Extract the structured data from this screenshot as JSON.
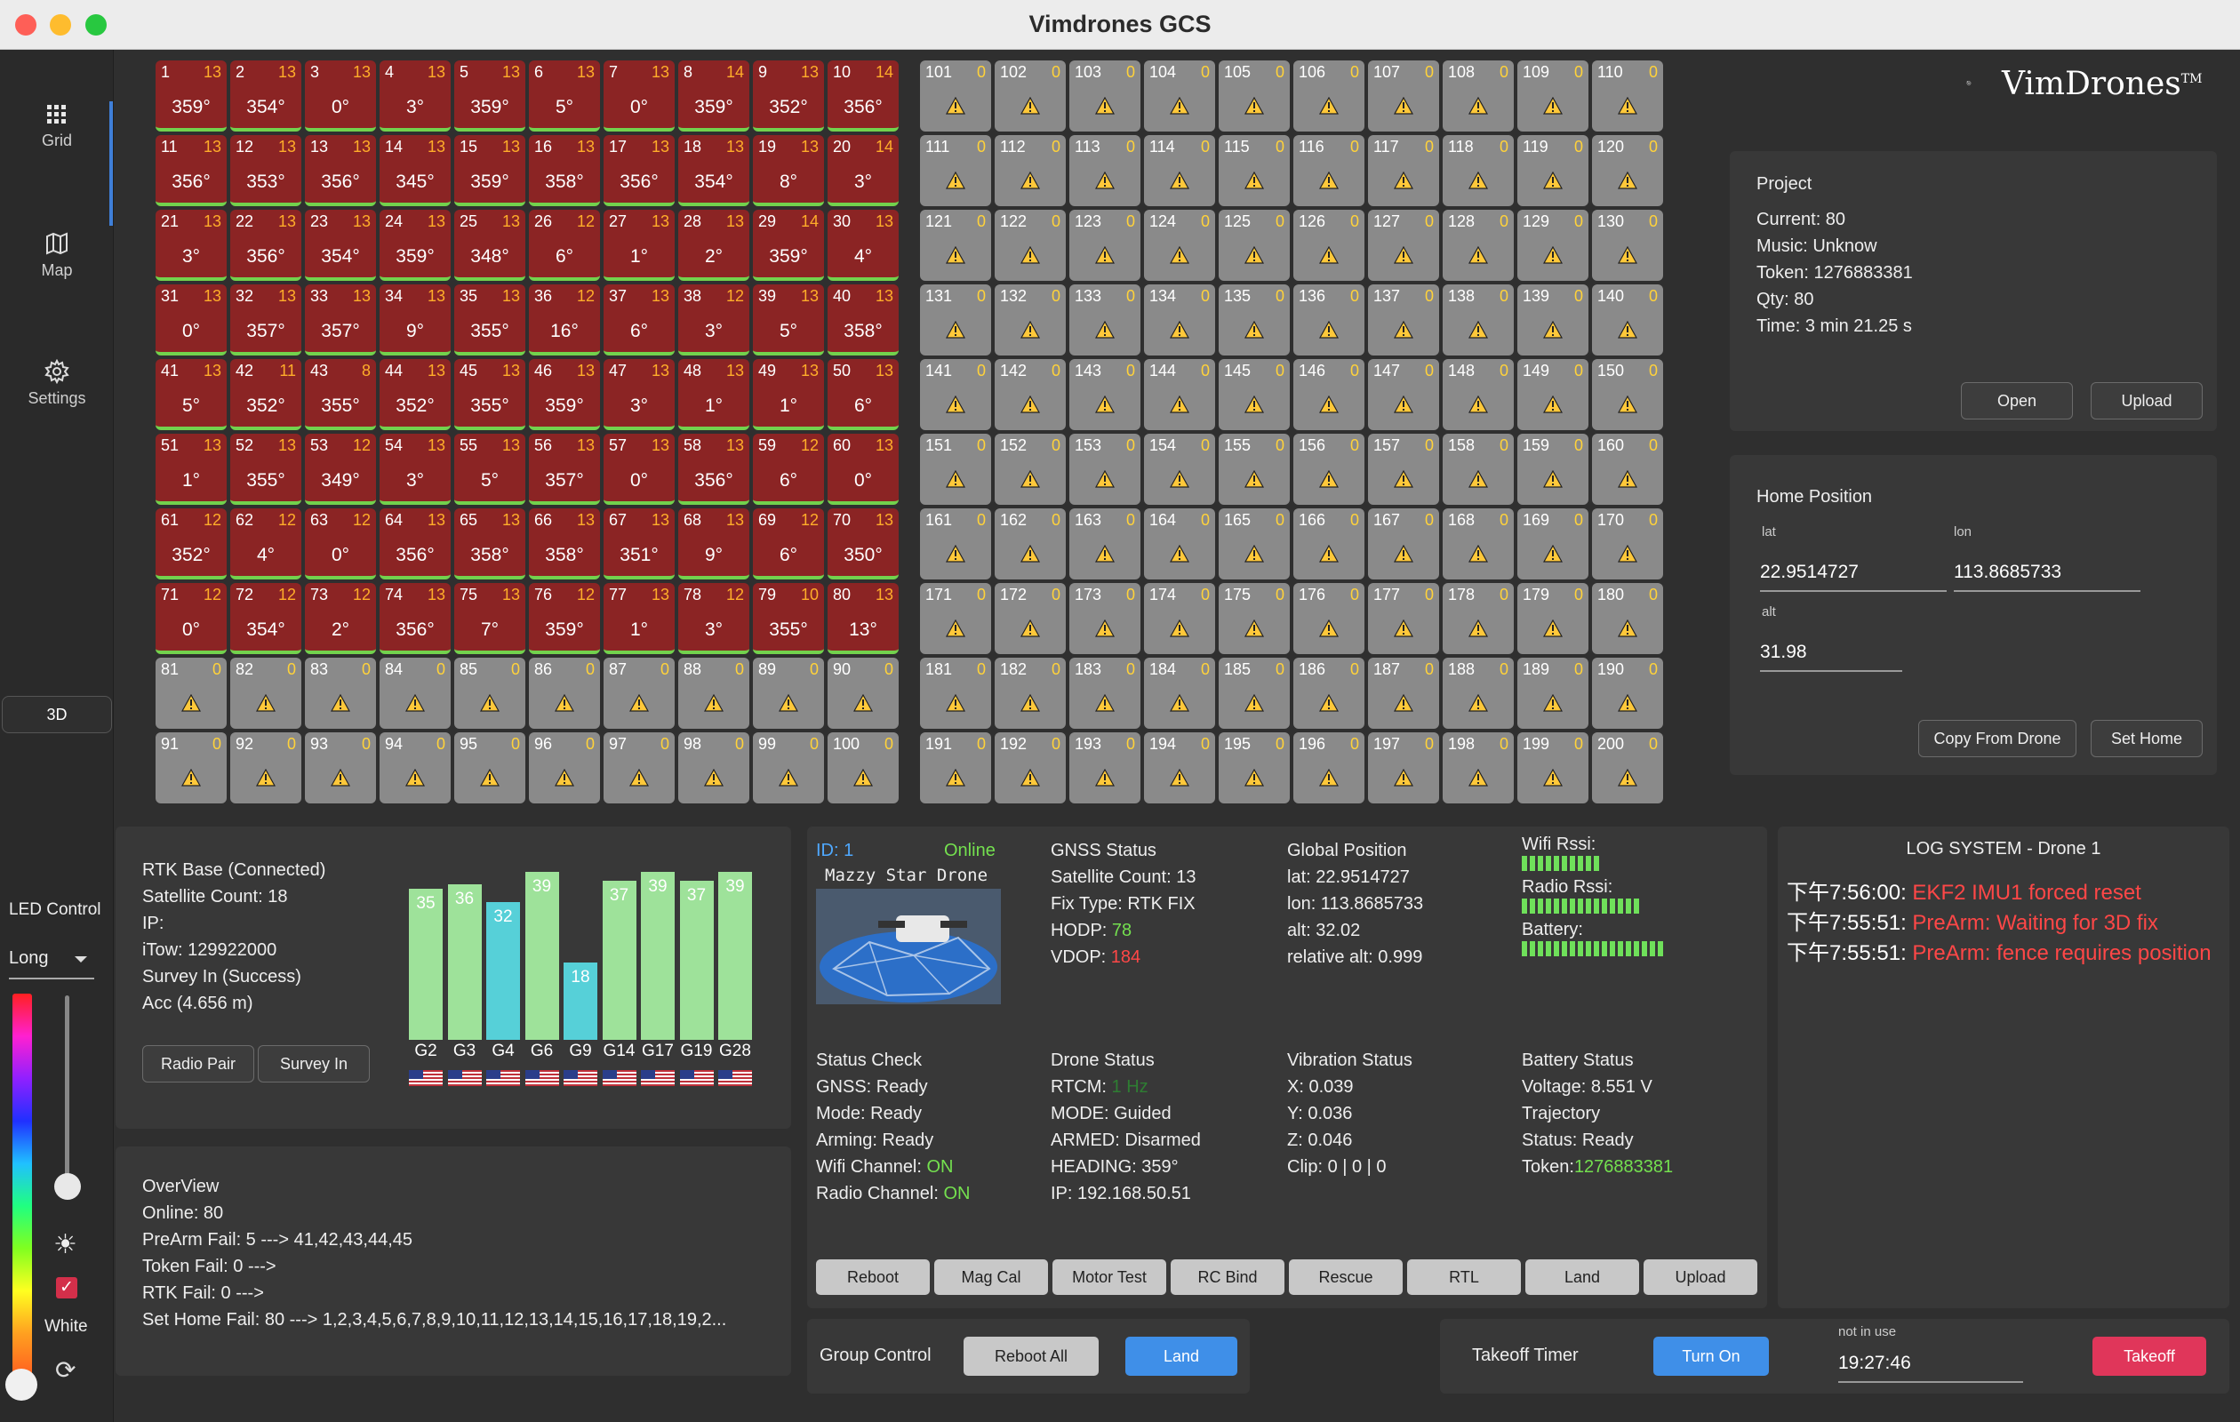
{
  "window": {
    "title": "Vimdrones GCS"
  },
  "sidebar": {
    "items": [
      {
        "label": "Grid",
        "icon": "grid-icon"
      },
      {
        "label": "Map",
        "icon": "map-icon"
      },
      {
        "label": "Settings",
        "icon": "gear-icon"
      }
    ],
    "view_toggle": "3D"
  },
  "led": {
    "title": "LED Control",
    "mode": "Long",
    "white_label": "White",
    "white_checked": true
  },
  "logo": {
    "text": "VimDrones",
    "tm": "TM"
  },
  "grid": {
    "online": [
      {
        "id": 1,
        "sat": 13,
        "heading": "359°"
      },
      {
        "id": 2,
        "sat": 13,
        "heading": "354°"
      },
      {
        "id": 3,
        "sat": 13,
        "heading": "0°"
      },
      {
        "id": 4,
        "sat": 13,
        "heading": "3°"
      },
      {
        "id": 5,
        "sat": 13,
        "heading": "359°"
      },
      {
        "id": 6,
        "sat": 13,
        "heading": "5°"
      },
      {
        "id": 7,
        "sat": 13,
        "heading": "0°"
      },
      {
        "id": 8,
        "sat": 14,
        "heading": "359°"
      },
      {
        "id": 9,
        "sat": 13,
        "heading": "352°"
      },
      {
        "id": 10,
        "sat": 14,
        "heading": "356°"
      },
      {
        "id": 11,
        "sat": 13,
        "heading": "356°"
      },
      {
        "id": 12,
        "sat": 13,
        "heading": "353°"
      },
      {
        "id": 13,
        "sat": 13,
        "heading": "356°"
      },
      {
        "id": 14,
        "sat": 13,
        "heading": "345°"
      },
      {
        "id": 15,
        "sat": 13,
        "heading": "359°"
      },
      {
        "id": 16,
        "sat": 13,
        "heading": "358°"
      },
      {
        "id": 17,
        "sat": 13,
        "heading": "356°"
      },
      {
        "id": 18,
        "sat": 13,
        "heading": "354°"
      },
      {
        "id": 19,
        "sat": 13,
        "heading": "8°"
      },
      {
        "id": 20,
        "sat": 14,
        "heading": "3°"
      },
      {
        "id": 21,
        "sat": 13,
        "heading": "3°"
      },
      {
        "id": 22,
        "sat": 13,
        "heading": "356°"
      },
      {
        "id": 23,
        "sat": 13,
        "heading": "354°"
      },
      {
        "id": 24,
        "sat": 13,
        "heading": "359°"
      },
      {
        "id": 25,
        "sat": 13,
        "heading": "348°"
      },
      {
        "id": 26,
        "sat": 12,
        "heading": "6°"
      },
      {
        "id": 27,
        "sat": 13,
        "heading": "1°"
      },
      {
        "id": 28,
        "sat": 13,
        "heading": "2°"
      },
      {
        "id": 29,
        "sat": 14,
        "heading": "359°"
      },
      {
        "id": 30,
        "sat": 13,
        "heading": "4°"
      },
      {
        "id": 31,
        "sat": 13,
        "heading": "0°"
      },
      {
        "id": 32,
        "sat": 13,
        "heading": "357°"
      },
      {
        "id": 33,
        "sat": 13,
        "heading": "357°"
      },
      {
        "id": 34,
        "sat": 13,
        "heading": "9°"
      },
      {
        "id": 35,
        "sat": 13,
        "heading": "355°"
      },
      {
        "id": 36,
        "sat": 12,
        "heading": "16°"
      },
      {
        "id": 37,
        "sat": 13,
        "heading": "6°"
      },
      {
        "id": 38,
        "sat": 12,
        "heading": "3°"
      },
      {
        "id": 39,
        "sat": 13,
        "heading": "5°"
      },
      {
        "id": 40,
        "sat": 13,
        "heading": "358°"
      },
      {
        "id": 41,
        "sat": 13,
        "heading": "5°"
      },
      {
        "id": 42,
        "sat": 11,
        "heading": "352°"
      },
      {
        "id": 43,
        "sat": 8,
        "heading": "355°"
      },
      {
        "id": 44,
        "sat": 13,
        "heading": "352°"
      },
      {
        "id": 45,
        "sat": 13,
        "heading": "355°"
      },
      {
        "id": 46,
        "sat": 13,
        "heading": "359°"
      },
      {
        "id": 47,
        "sat": 13,
        "heading": "3°"
      },
      {
        "id": 48,
        "sat": 13,
        "heading": "1°"
      },
      {
        "id": 49,
        "sat": 13,
        "heading": "1°"
      },
      {
        "id": 50,
        "sat": 13,
        "heading": "6°"
      },
      {
        "id": 51,
        "sat": 13,
        "heading": "1°"
      },
      {
        "id": 52,
        "sat": 13,
        "heading": "355°"
      },
      {
        "id": 53,
        "sat": 12,
        "heading": "349°"
      },
      {
        "id": 54,
        "sat": 13,
        "heading": "3°"
      },
      {
        "id": 55,
        "sat": 13,
        "heading": "5°"
      },
      {
        "id": 56,
        "sat": 13,
        "heading": "357°"
      },
      {
        "id": 57,
        "sat": 13,
        "heading": "0°"
      },
      {
        "id": 58,
        "sat": 13,
        "heading": "356°"
      },
      {
        "id": 59,
        "sat": 12,
        "heading": "6°"
      },
      {
        "id": 60,
        "sat": 13,
        "heading": "0°"
      },
      {
        "id": 61,
        "sat": 12,
        "heading": "352°"
      },
      {
        "id": 62,
        "sat": 12,
        "heading": "4°"
      },
      {
        "id": 63,
        "sat": 12,
        "heading": "0°"
      },
      {
        "id": 64,
        "sat": 13,
        "heading": "356°"
      },
      {
        "id": 65,
        "sat": 13,
        "heading": "358°"
      },
      {
        "id": 66,
        "sat": 13,
        "heading": "358°"
      },
      {
        "id": 67,
        "sat": 13,
        "heading": "351°"
      },
      {
        "id": 68,
        "sat": 13,
        "heading": "9°"
      },
      {
        "id": 69,
        "sat": 12,
        "heading": "6°"
      },
      {
        "id": 70,
        "sat": 13,
        "heading": "350°"
      },
      {
        "id": 71,
        "sat": 12,
        "heading": "0°"
      },
      {
        "id": 72,
        "sat": 12,
        "heading": "354°"
      },
      {
        "id": 73,
        "sat": 12,
        "heading": "2°"
      },
      {
        "id": 74,
        "sat": 13,
        "heading": "356°"
      },
      {
        "id": 75,
        "sat": 13,
        "heading": "7°"
      },
      {
        "id": 76,
        "sat": 12,
        "heading": "359°"
      },
      {
        "id": 77,
        "sat": 13,
        "heading": "1°"
      },
      {
        "id": 78,
        "sat": 12,
        "heading": "3°"
      },
      {
        "id": 79,
        "sat": 10,
        "heading": "355°"
      },
      {
        "id": 80,
        "sat": 13,
        "heading": "13°"
      }
    ],
    "offline_sat": 0,
    "total": 200
  },
  "project": {
    "title": "Project",
    "current": "Current: 80",
    "music": "Music: Unknow",
    "token": "Token: 1276883381",
    "qty": "Qty: 80",
    "time": "Time: 3 min 21.25 s",
    "open_label": "Open",
    "upload_label": "Upload"
  },
  "home": {
    "title": "Home Position",
    "lat_label": "lat",
    "lat": "22.9514727",
    "lon_label": "lon",
    "lon": "113.8685733",
    "alt_label": "alt",
    "alt": "31.98",
    "copy_label": "Copy From Drone",
    "set_label": "Set Home"
  },
  "rtk": {
    "lines": [
      "RTK Base (Connected)",
      "Satellite Count: 18",
      "IP:",
      "iTow: 129922000",
      "Survey In (Success)",
      "Acc (4.656 m)"
    ],
    "radio_pair_label": "Radio Pair",
    "survey_in_label": "Survey In"
  },
  "chart_data": {
    "type": "bar",
    "categories": [
      "G2",
      "G3",
      "G4",
      "G6",
      "G9",
      "G14",
      "G17",
      "G19",
      "G28"
    ],
    "values": [
      35,
      36,
      32,
      39,
      18,
      37,
      39,
      37,
      39
    ],
    "colors": [
      "#9ee29a",
      "#9ee29a",
      "#56d0d8",
      "#9ee29a",
      "#56d0d8",
      "#9ee29a",
      "#9ee29a",
      "#9ee29a",
      "#9ee29a"
    ],
    "ylim": [
      0,
      40
    ]
  },
  "overview": {
    "title": "OverView",
    "lines": [
      "Online: 80",
      "PreArm Fail: 5 ---> 41,42,43,44,45",
      "Token Fail: 0 --->",
      "RTK Fail: 0 --->",
      "Set Home Fail: 80 ---> 1,2,3,4,5,6,7,8,9,10,11,12,13,14,15,16,17,18,19,2..."
    ]
  },
  "drone": {
    "id_label": "ID: 1",
    "online_label": "Online",
    "name": "Mazzy Star Drone",
    "gnss": {
      "title": "GNSS Status",
      "sat": "Satellite Count: 13",
      "fix": "Fix Type: RTK FIX",
      "hdop_label": "HODP: ",
      "hdop": "78",
      "vdop_label": "VDOP: ",
      "vdop": "184"
    },
    "global": {
      "title": "Global Position",
      "lat": "lat: 22.9514727",
      "lon": "lon: 113.8685733",
      "alt": "alt: 32.02",
      "rel": "relative alt: 0.999"
    },
    "rssi": {
      "wifi": "Wifi Rssi:",
      "radio": "Radio Rssi:",
      "battery": "Battery:",
      "wifi_bars": 10,
      "radio_bars": 15,
      "battery_bars": 18
    },
    "status_check": {
      "title": "Status Check",
      "gnss": "GNSS: Ready",
      "mode": "Mode: Ready",
      "arming": "Arming: Ready",
      "wifi_label": "Wifi Channel: ",
      "wifi": "ON",
      "radio_label": "Radio Channel: ",
      "radio": "ON"
    },
    "drone_status": {
      "title": "Drone Status",
      "rtcm_label": "RTCM: ",
      "rtcm": "1 Hz",
      "mode": "MODE: Guided",
      "armed": "ARMED: Disarmed",
      "heading": "HEADING: 359°",
      "ip": "IP: 192.168.50.51"
    },
    "vibration": {
      "title": "Vibration Status",
      "x": "X: 0.039",
      "y": "Y: 0.036",
      "z": "Z: 0.046",
      "clip": "Clip: 0 | 0 | 0"
    },
    "battery": {
      "title": "Battery Status",
      "voltage": "Voltage: 8.551 V",
      "trajectory": "Trajectory",
      "status": "Status: Ready",
      "token_label": "Token:",
      "token": "1276883381"
    },
    "buttons": [
      "Reboot",
      "Mag Cal",
      "Motor Test",
      "RC Bind",
      "Rescue",
      "RTL",
      "Land",
      "Upload"
    ]
  },
  "log": {
    "title": "LOG SYSTEM - Drone 1",
    "entries": [
      {
        "time": "下午7:56:00: ",
        "msg": "EKF2 IMU1 forced reset"
      },
      {
        "time": "下午7:55:51: ",
        "msg": "PreArm: Waiting for 3D fix"
      },
      {
        "time": "下午7:55:51: ",
        "msg": "PreArm: fence requires position"
      }
    ]
  },
  "group": {
    "title": "Group Control",
    "reboot_all": "Reboot All",
    "land": "Land"
  },
  "takeoff": {
    "title": "Takeoff Timer",
    "turn_on": "Turn On",
    "field_label": "not in use",
    "time": "19:27:46",
    "takeoff": "Takeoff"
  },
  "colors": {
    "accent": "#3f8fe8",
    "danger": "#e0365a",
    "ok_cell": "#8b2424",
    "offline_cell": "#8a8a8a",
    "green": "#74e04f",
    "red": "#ff4747"
  }
}
